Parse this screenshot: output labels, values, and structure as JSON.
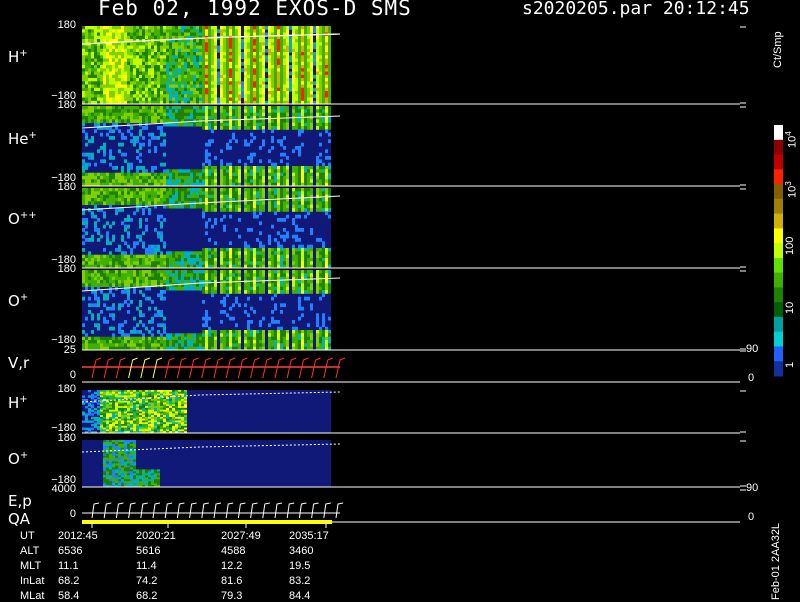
{
  "header": {
    "title": "Feb 02, 1992   EXOS-D SMS",
    "file": "s2020205.par  20:12:45"
  },
  "panels": {
    "h_plus": {
      "label_main": "H",
      "label_sup": "+",
      "ytop": "180",
      "ybot": "−180"
    },
    "he_plus": {
      "label_main": "He",
      "label_sup": "+",
      "ytop": "180",
      "ybot": "−180"
    },
    "o_plusplus": {
      "label_main": "O",
      "label_sup": "++",
      "ytop": "180",
      "ybot": "−180"
    },
    "o_plus": {
      "label_main": "O",
      "label_sup": "+",
      "ytop": "180",
      "ybot": "−180"
    },
    "vr": {
      "label": "V,r",
      "ytop": "25",
      "ybot": "0",
      "rtop": "90",
      "rbot": "0"
    },
    "h_plus_2": {
      "label_main": "H",
      "label_sup": "+",
      "ytop": "180",
      "ybot": "−180"
    },
    "o_plus_2": {
      "label_main": "O",
      "label_sup": "+",
      "ytop": "180",
      "ybot": "−180"
    },
    "ep": {
      "label1": "E,p",
      "label2": "QA",
      "ytop": "4000",
      "ybot": "0",
      "rtop": "90",
      "rbot": "0"
    }
  },
  "colorbar": {
    "unit": "Ct/Smp",
    "ticks": [
      {
        "main": "10",
        "sup": "4"
      },
      {
        "main": "10",
        "sup": "3"
      },
      {
        "main": "100",
        "sup": ""
      },
      {
        "main": "10",
        "sup": ""
      },
      {
        "main": "1",
        "sup": ""
      }
    ],
    "colors": [
      "#ffffff",
      "#8b0000",
      "#c00000",
      "#ff2000",
      "#806000",
      "#a08000",
      "#d0b000",
      "#ffff00",
      "#c0ff00",
      "#60e000",
      "#40b000",
      "#208000",
      "#006000",
      "#00a0a0",
      "#00d0d0",
      "#2060ff",
      "#1030a0"
    ]
  },
  "ephemeris": {
    "rows": [
      {
        "name": "UT",
        "values": [
          "2012:45",
          "2020:21",
          "2027:49",
          "2035:17"
        ]
      },
      {
        "name": "ALT",
        "values": [
          "6536",
          "5616",
          "4588",
          "3460"
        ]
      },
      {
        "name": "MLT",
        "values": [
          "11.1",
          "11.4",
          "12.2",
          "19.5"
        ]
      },
      {
        "name": "InLat",
        "values": [
          "68.2",
          "74.2",
          "81.6",
          "83.2"
        ]
      },
      {
        "name": "MLat",
        "values": [
          "58.4",
          "68.2",
          "79.3",
          "84.4"
        ]
      }
    ]
  },
  "side_id": "Feb-01 2AA32L",
  "chart_data": {
    "type": "heatmap",
    "title": "Feb 02, 1992   EXOS-D SMS",
    "x_axis": {
      "label": "UT",
      "ticks": [
        "2012:45",
        "2020:21",
        "2027:49",
        "2035:17"
      ]
    },
    "series": [
      {
        "name": "H+",
        "ylim": [
          -180,
          180
        ]
      },
      {
        "name": "He+",
        "ylim": [
          -180,
          180
        ]
      },
      {
        "name": "O++",
        "ylim": [
          -180,
          180
        ]
      },
      {
        "name": "O+",
        "ylim": [
          -180,
          180
        ]
      },
      {
        "name": "V,r",
        "ylim": [
          0,
          25
        ],
        "right_ylim": [
          0,
          90
        ]
      },
      {
        "name": "H+",
        "ylim": [
          -180,
          180
        ]
      },
      {
        "name": "O+",
        "ylim": [
          -180,
          180
        ]
      },
      {
        "name": "E,p",
        "ylim": [
          0,
          4000
        ],
        "right_ylim": [
          0,
          90
        ]
      }
    ],
    "colorscale": {
      "unit": "Ct/Smp",
      "scale": "log",
      "range": [
        1,
        10000
      ]
    }
  }
}
